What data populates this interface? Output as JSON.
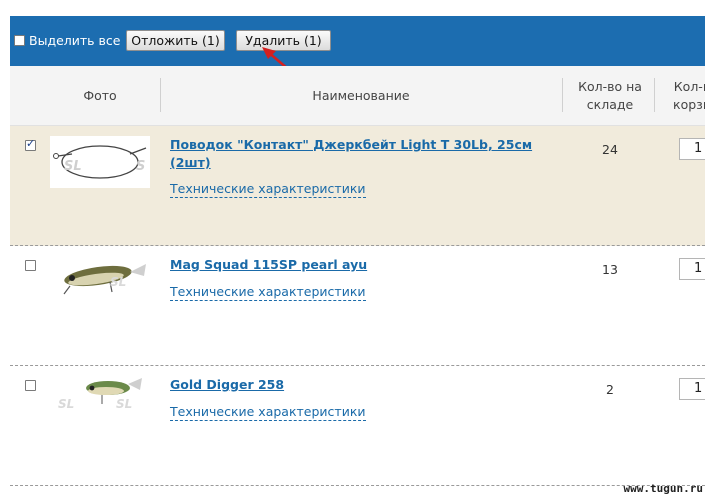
{
  "toolbar": {
    "select_all_label": "Выделить все",
    "postpone_label": "Отложить (1)",
    "delete_label": "Удалить (1)"
  },
  "columns": {
    "photo": "Фото",
    "name": "Наименование",
    "stock": "Кол-во на складе",
    "in_cart": "Кол-в корзи"
  },
  "items": [
    {
      "name": "Поводок \"Контакт\" Джеркбейт Light T 30Lb, 25см (2шт)",
      "specs": "Технические характеристики",
      "stock": "24",
      "qty": "1",
      "checked": true,
      "thumb_icon": "leader-wire-icon"
    },
    {
      "name": "Mag Squad 115SP pearl ayu",
      "specs": "Технические характеристики",
      "stock": "13",
      "qty": "1",
      "checked": false,
      "thumb_icon": "lure-icon"
    },
    {
      "name": "Gold Digger 258",
      "specs": "Технические характеристики",
      "stock": "2",
      "qty": "1",
      "checked": false,
      "thumb_icon": "lure-icon"
    }
  ],
  "watermark": "www.tugun.ru",
  "colors": {
    "toolbar_bg": "#1c6db0",
    "selected_row_bg": "#f1ebdc",
    "link": "#1a6aa8",
    "arrow": "#d42020"
  }
}
